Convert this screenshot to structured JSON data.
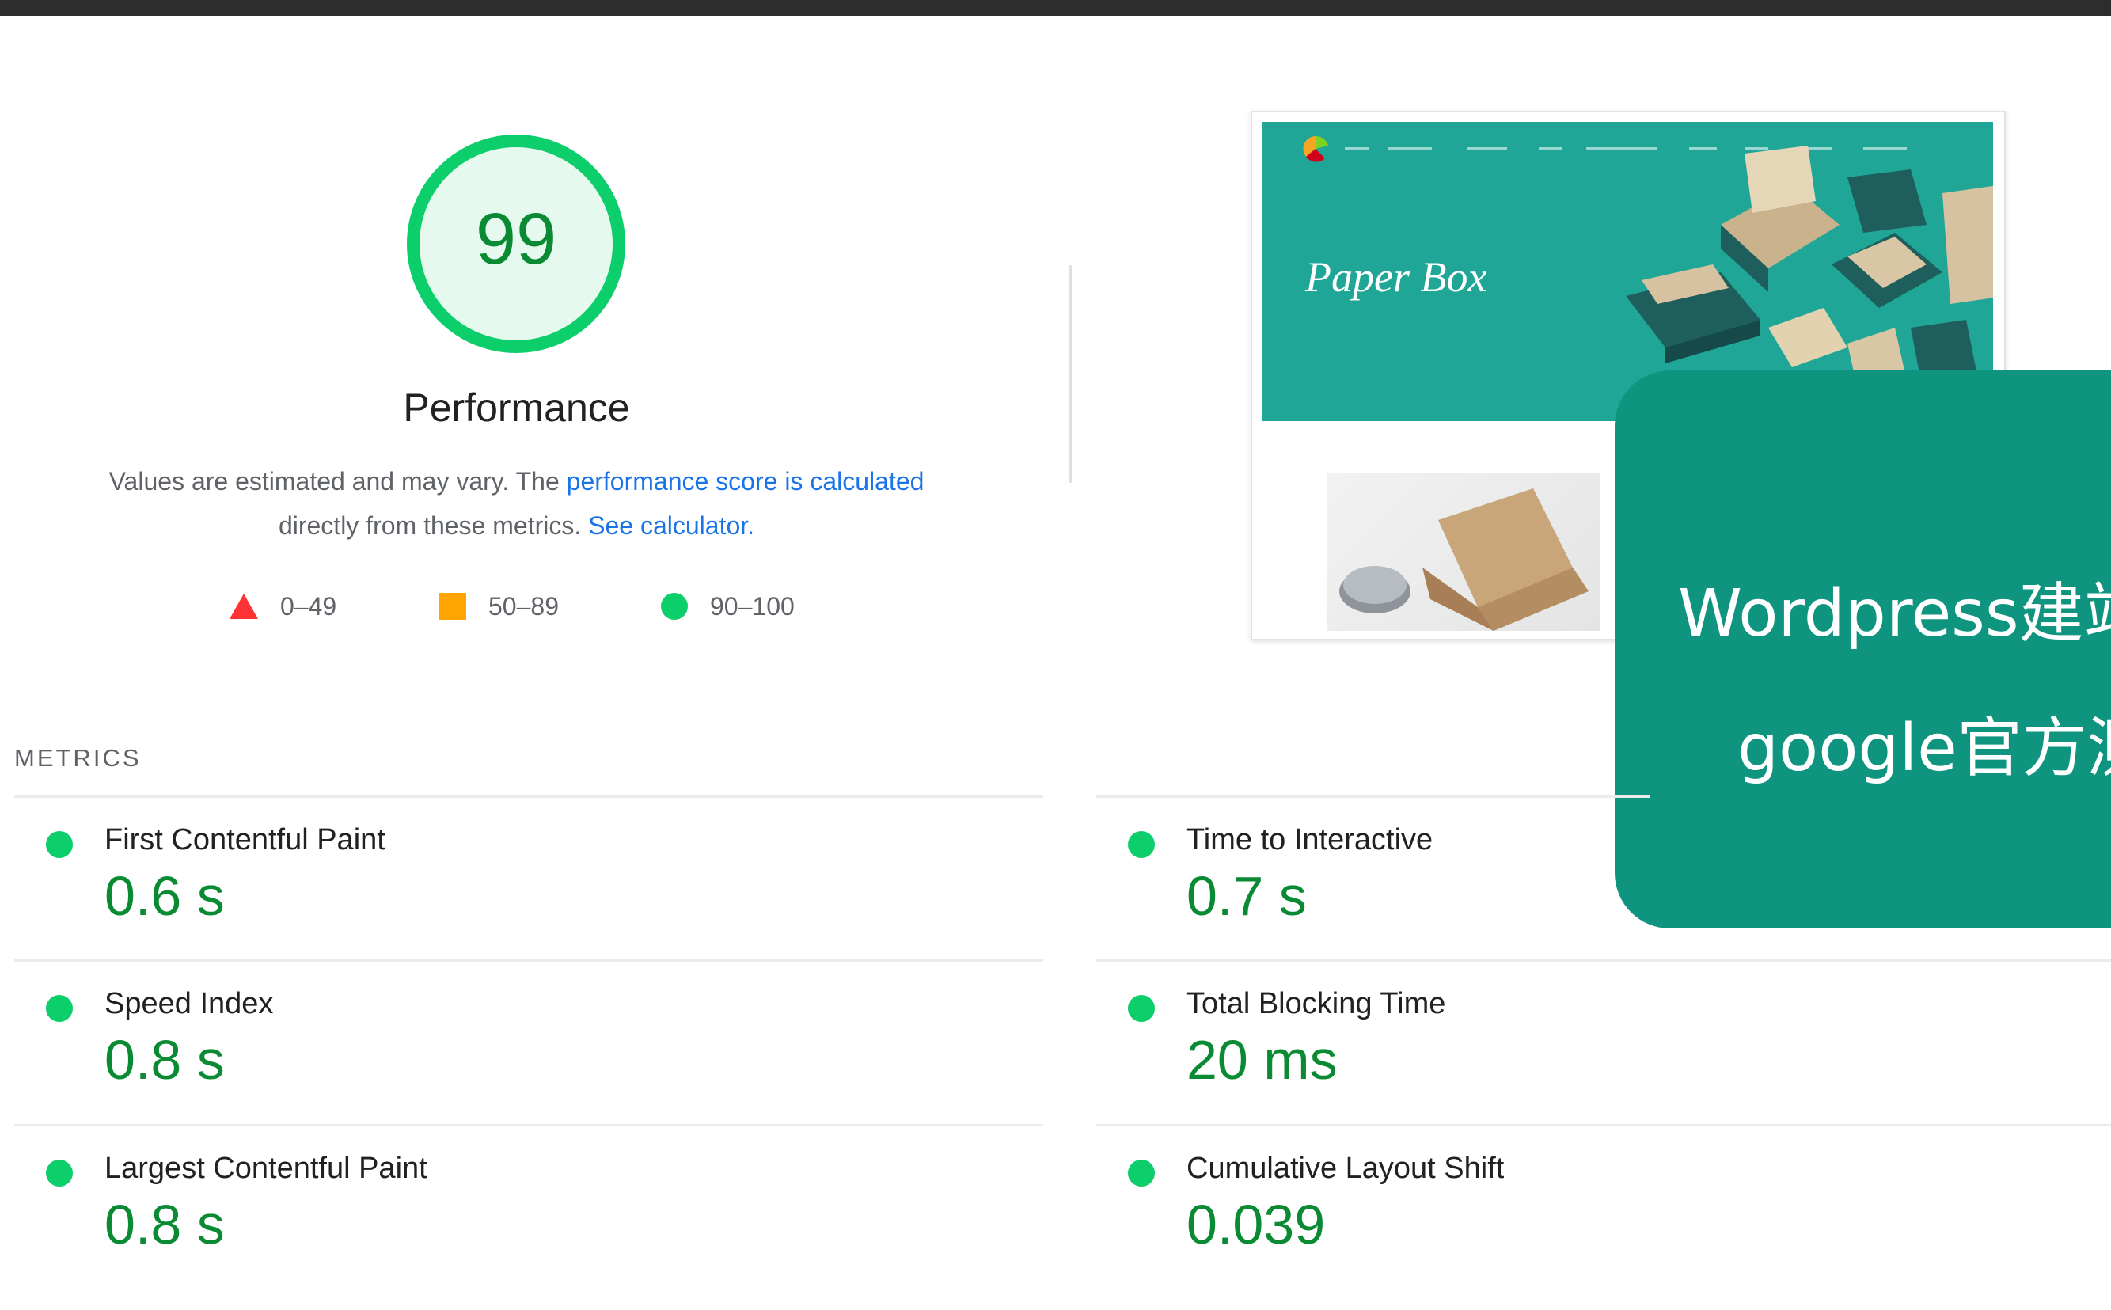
{
  "score": {
    "value": "99",
    "title": "Performance"
  },
  "description": {
    "text_before": "Values are estimated and may vary. The ",
    "link_score": "performance score is calculated",
    "text_mid": " directly from these metrics. ",
    "link_calculator": "See calculator."
  },
  "legend": [
    {
      "shape": "triangle",
      "label": "0–49",
      "color": "#ff3333"
    },
    {
      "shape": "square",
      "label": "50–89",
      "color": "#ffa400"
    },
    {
      "shape": "circle",
      "label": "90–100",
      "color": "#0cce6b"
    }
  ],
  "thumbnail": {
    "hero_title": "Paper Box"
  },
  "overlay": {
    "line1": "Wordpress建站",
    "line2": "google官方测"
  },
  "metrics": {
    "label": "METRICS",
    "items": [
      {
        "name": "First Contentful Paint",
        "value": "0.6 s"
      },
      {
        "name": "Time to Interactive",
        "value": "0.7 s"
      },
      {
        "name": "Speed Index",
        "value": "0.8 s"
      },
      {
        "name": "Total Blocking Time",
        "value": "20 ms"
      },
      {
        "name": "Largest Contentful Paint",
        "value": "0.8 s"
      },
      {
        "name": "Cumulative Layout Shift",
        "value": "0.039"
      }
    ]
  },
  "colors": {
    "pass": "#0cce6b",
    "pass_text": "#0b8a34",
    "overlay_bg": "#0f957f",
    "hero_bg": "#1fa697"
  }
}
